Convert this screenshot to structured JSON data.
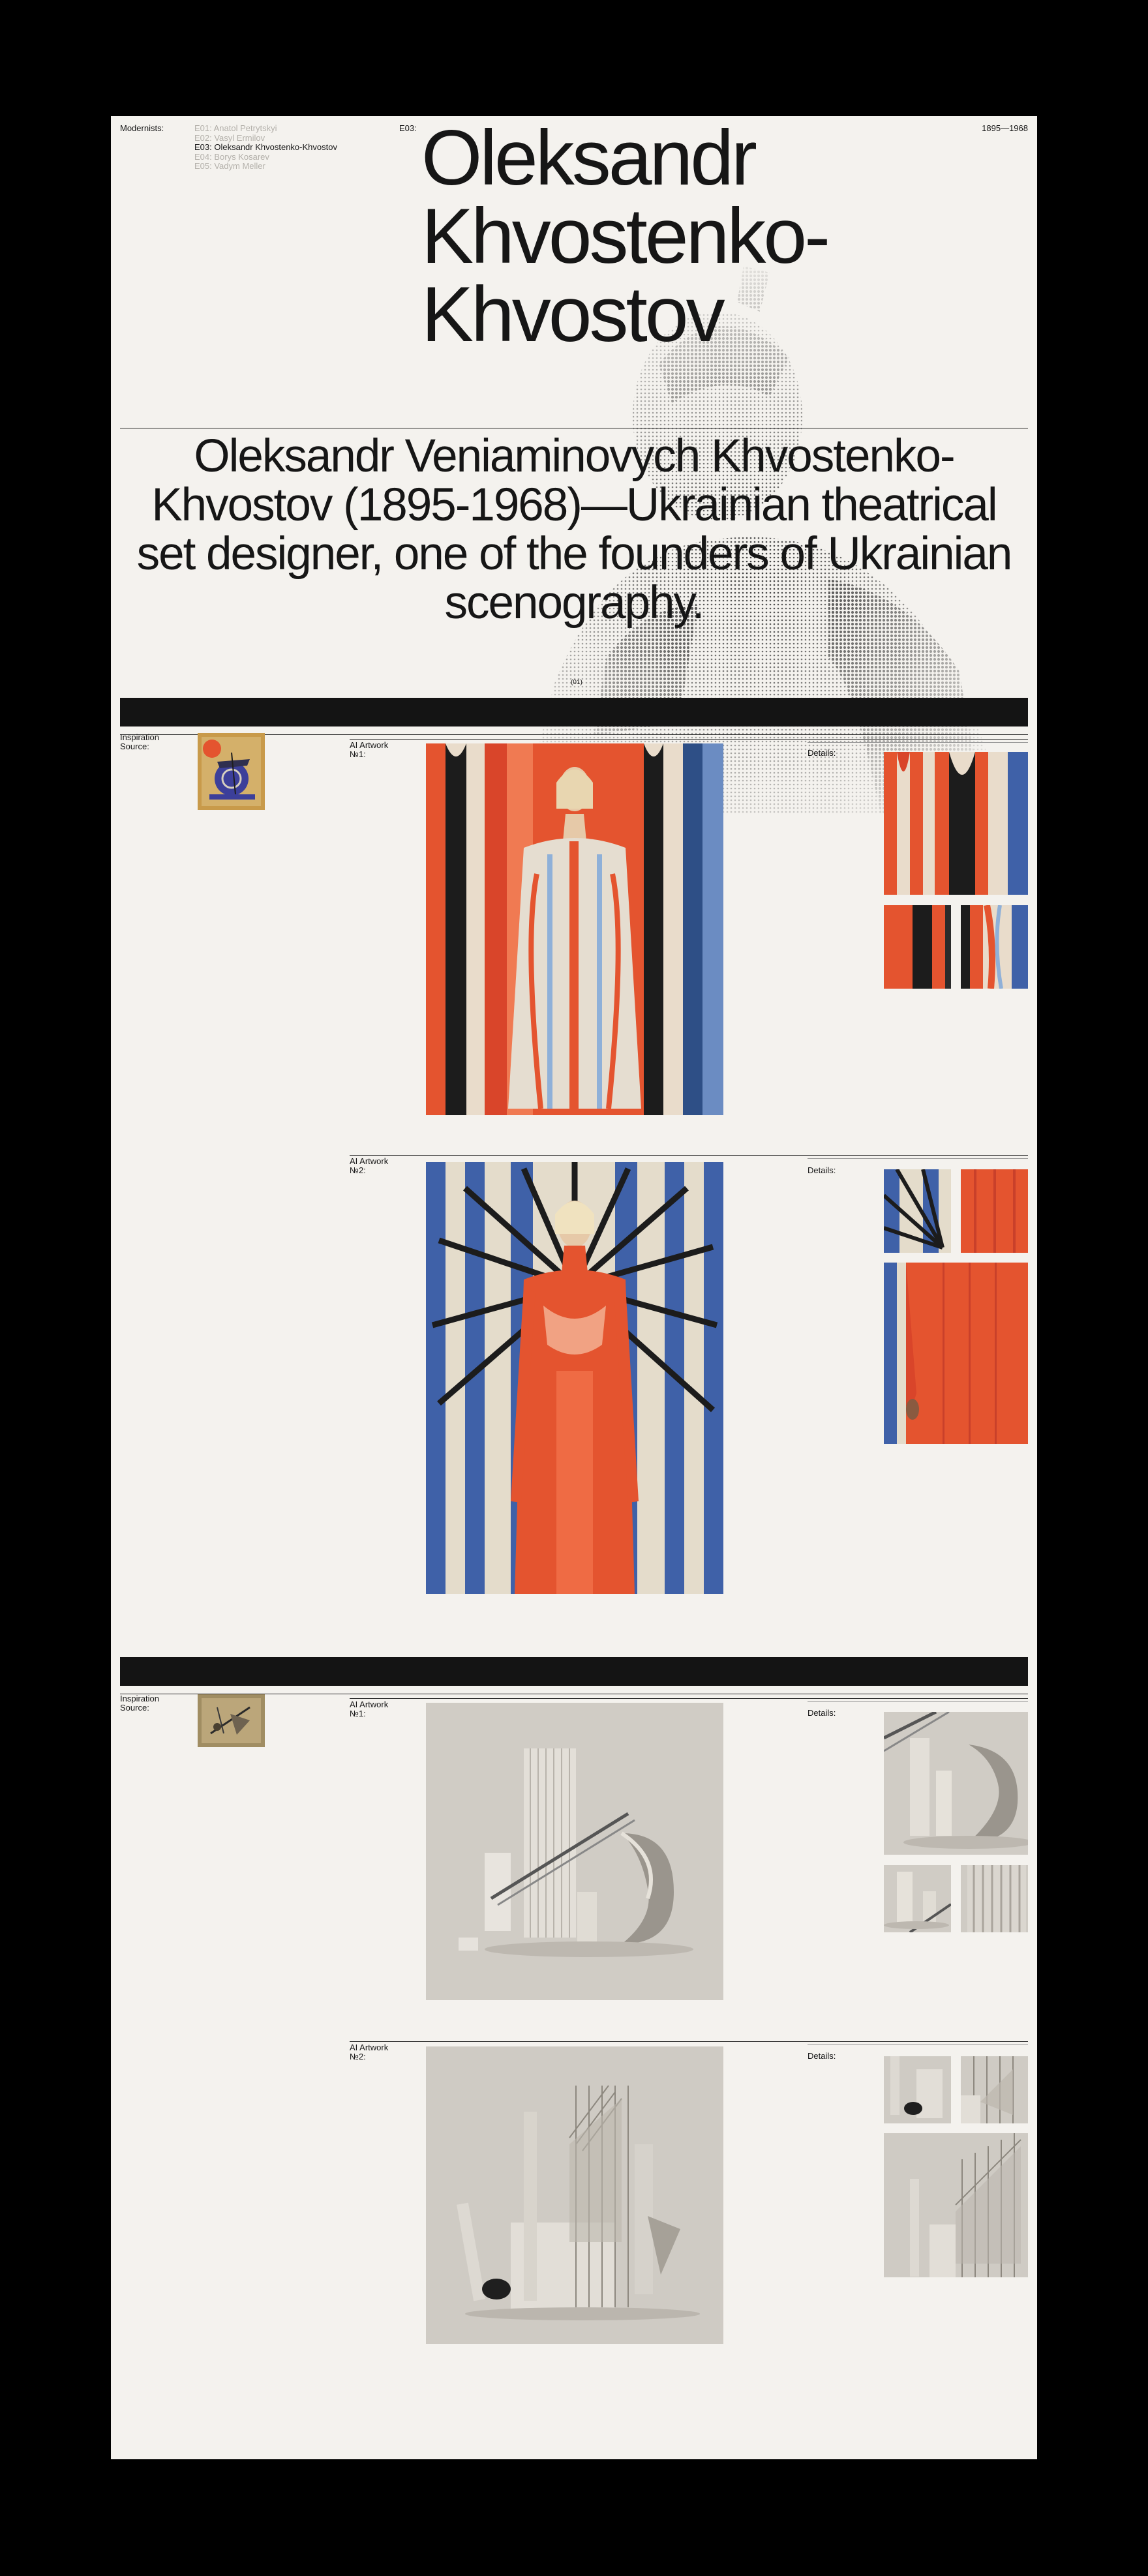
{
  "header": {
    "label": "Modernists:",
    "episode_code": "E03:",
    "years": "1895—1968"
  },
  "nav": {
    "items": [
      {
        "label": "E01: Anatol Petrytskyi",
        "active": false
      },
      {
        "label": "E02: Vasyl Ermilov",
        "active": false
      },
      {
        "label": "E03: Oleksandr Khvostenko-Khvostov",
        "active": true
      },
      {
        "label": "E04: Borys Kosarev",
        "active": false
      },
      {
        "label": "E05: Vadym Meller",
        "active": false
      }
    ]
  },
  "title": "Oleksandr\nKhvostenko-\nKhvostov",
  "subtitle": "Oleksandr Veniaminovych Khvostenko-Khvostov (1895-1968)—Ukrainian theatrical set designer, one of the founders of Ukrainian scenography.",
  "photo_caption": "(01)",
  "sections": [
    {
      "inspiration_label": "Inspiration Source:",
      "artworks": [
        {
          "label": "AI Artwork №1:",
          "details_label": "Details:"
        },
        {
          "label": "AI Artwork №2:",
          "details_label": "Details:"
        }
      ]
    },
    {
      "inspiration_label": "Inspiration Source:",
      "artworks": [
        {
          "label": "AI Artwork №1:",
          "details_label": "Details:"
        },
        {
          "label": "AI Artwork №2:",
          "details_label": "Details:"
        }
      ]
    }
  ],
  "colors": {
    "background": "#000000",
    "page": "#f4f2ee",
    "ink": "#161616",
    "muted": "#b3b0aa",
    "orange": "#e4542f",
    "blue": "#3f61a8",
    "cream": "#e4dccb",
    "stone": "#cfcbc4"
  }
}
